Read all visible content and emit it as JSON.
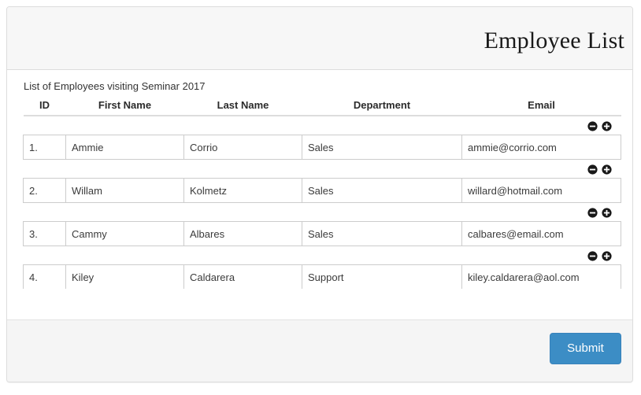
{
  "header": {
    "title": "Employee List"
  },
  "body": {
    "caption": "List of Employees visiting Seminar 2017",
    "table": {
      "columns": [
        "ID",
        "First Name",
        "Last Name",
        "Department",
        "Email"
      ],
      "row_controls": {
        "remove_icon": "minus-circle-icon",
        "add_icon": "plus-circle-icon"
      },
      "rows": [
        {
          "id": "1.",
          "first_name": "Ammie",
          "last_name": "Corrio",
          "department": "Sales",
          "email": "ammie@corrio.com"
        },
        {
          "id": "2.",
          "first_name": "Willam",
          "last_name": "Kolmetz",
          "department": "Sales",
          "email": "willard@hotmail.com"
        },
        {
          "id": "3.",
          "first_name": "Cammy",
          "last_name": "Albares",
          "department": "Sales",
          "email": "calbares@email.com"
        },
        {
          "id": "4.",
          "first_name": "Kiley",
          "last_name": "Caldarera",
          "department": "Support",
          "email": "kiley.caldarera@aol.com"
        }
      ]
    }
  },
  "footer": {
    "submit_label": "Submit"
  },
  "colors": {
    "submit_button": "#3c8dc5",
    "panel_border": "#dddddd",
    "header_background": "#f7f7f7",
    "footer_background": "#f5f5f5",
    "icon": "#181818",
    "table_border": "#cccccc"
  }
}
